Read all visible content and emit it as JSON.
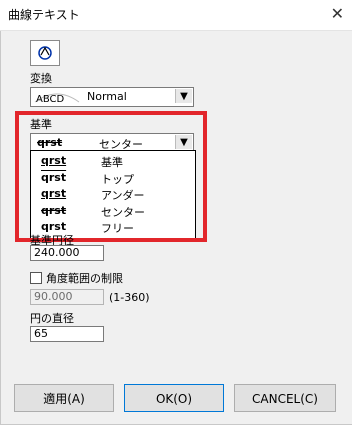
{
  "window": {
    "title": "曲線テキスト"
  },
  "labels": {
    "transform": "変換",
    "baseline": "基準",
    "baseline_diameter": "基準円径",
    "angle_limit": "角度範囲の制限",
    "angle_range": "(1-360)",
    "circle_diameter": "円の直径"
  },
  "transform_combo": {
    "sample": "ABCD",
    "value": "Normal"
  },
  "baseline_combo": {
    "sample": "qrst",
    "value": "センター"
  },
  "dropdown": [
    {
      "sample": "qrst",
      "label": "基準"
    },
    {
      "sample": "qrst",
      "label": "トップ"
    },
    {
      "sample": "qrst",
      "label": "アンダー"
    },
    {
      "sample": "qrst",
      "label": "センター"
    },
    {
      "sample": "qrst",
      "label": "フリー"
    }
  ],
  "fields": {
    "baseline_diameter": "240.000",
    "angle": "90.000",
    "circle_diameter": "65"
  },
  "buttons": {
    "apply": "適用(A)",
    "ok": "OK(O)",
    "cancel": "CANCEL(C)"
  }
}
